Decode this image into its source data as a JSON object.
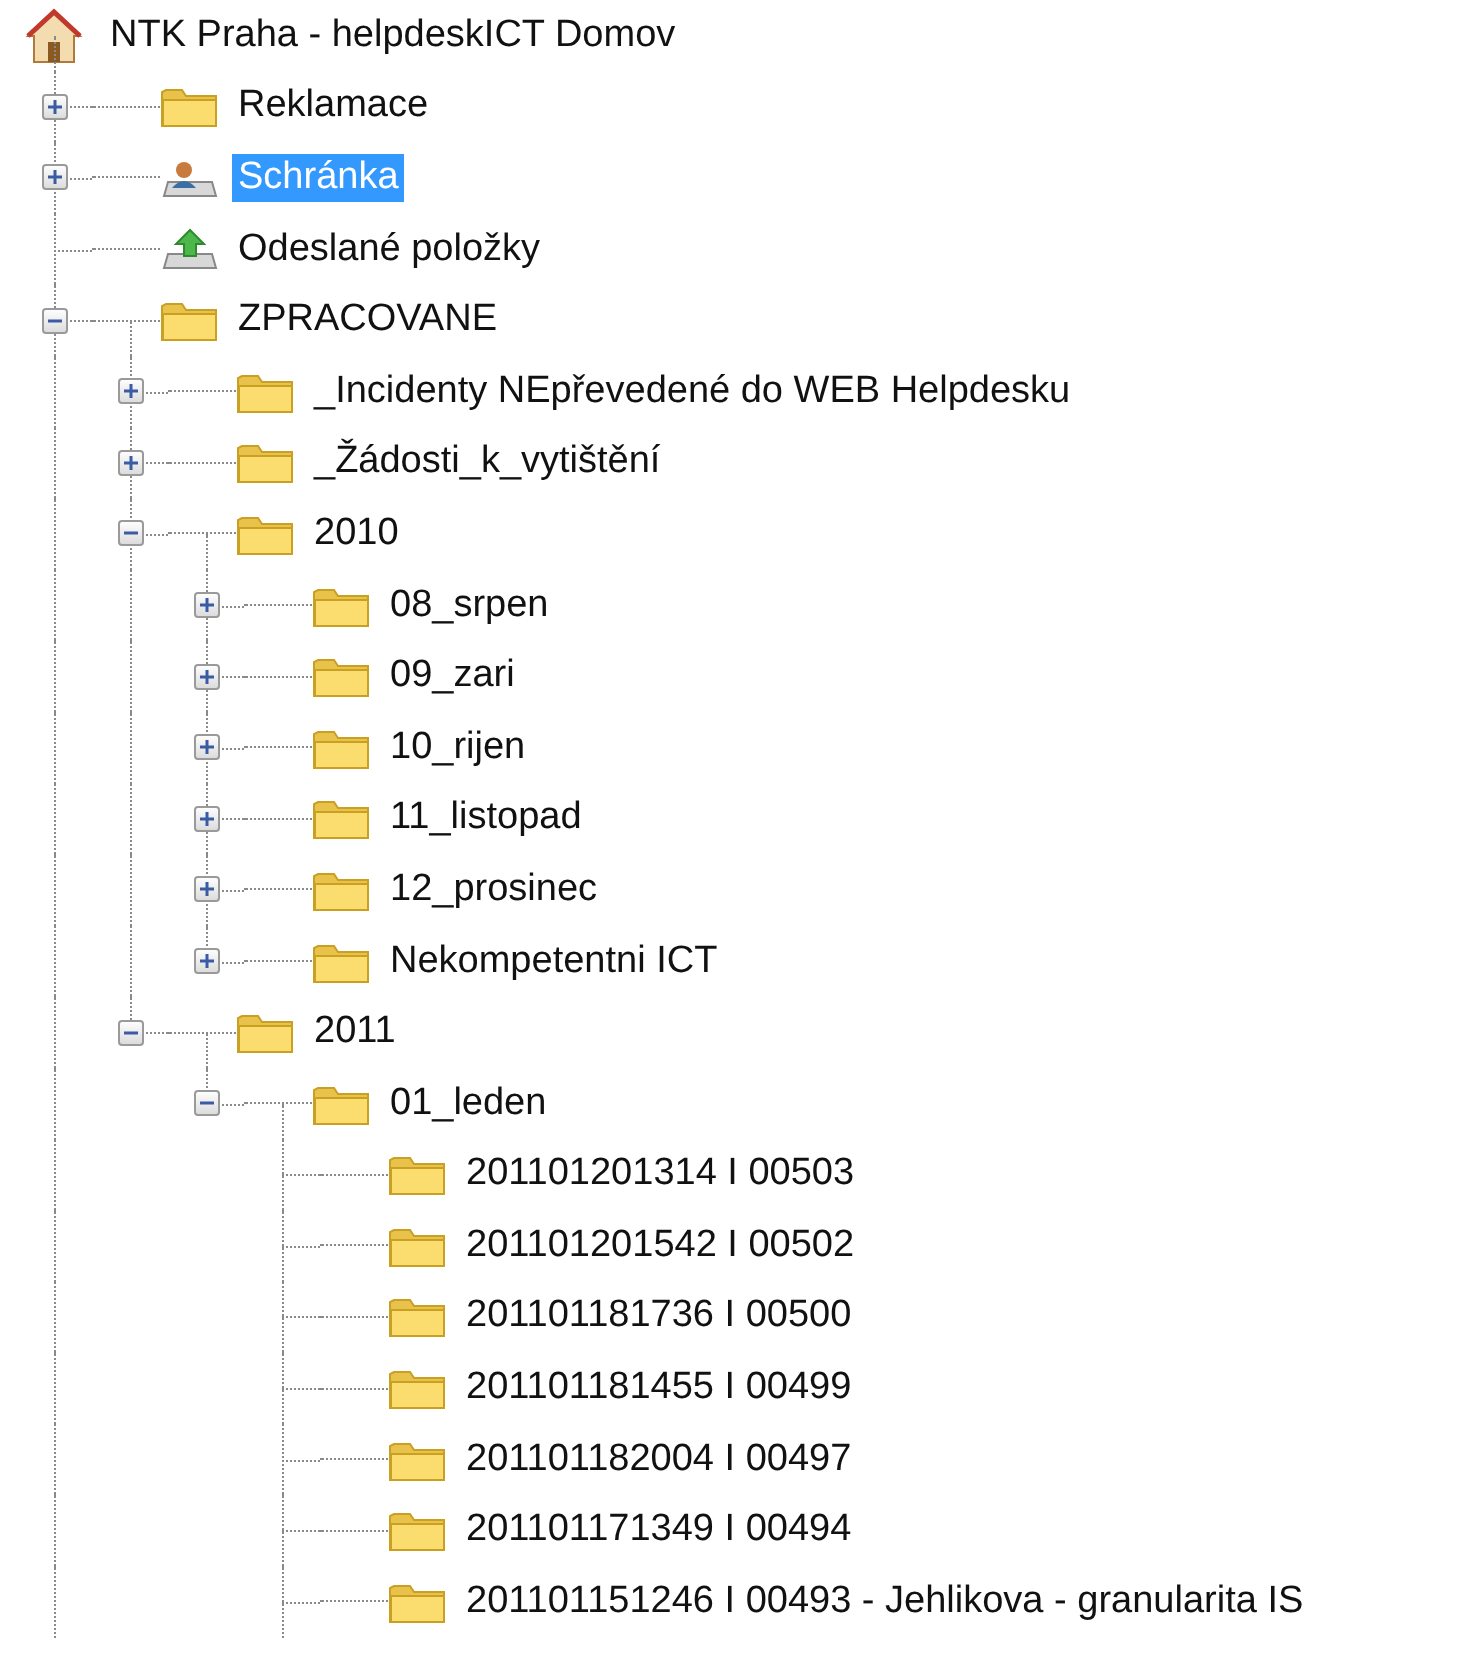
{
  "tree": {
    "label": "NTK Praha - helpdeskICT Domov",
    "kind": "home",
    "selected": false,
    "children": [
      {
        "label": "Reklamace",
        "kind": "folder",
        "selected": false,
        "expanded": false
      },
      {
        "label": "Schránka",
        "kind": "inbox",
        "selected": true,
        "expanded": false
      },
      {
        "label": "Odeslané položky",
        "kind": "outbox",
        "selected": false
      },
      {
        "label": "ZPRACOVANE",
        "kind": "folder",
        "selected": false,
        "expanded": true,
        "more_below": true,
        "children": [
          {
            "label": "_Incidenty NEpřevedené do WEB Helpdesku",
            "kind": "folder",
            "selected": false,
            "expanded": false
          },
          {
            "label": "_Žádosti_k_vytištění",
            "kind": "folder",
            "selected": false,
            "expanded": false
          },
          {
            "label": "2010",
            "kind": "folder",
            "selected": false,
            "expanded": true,
            "children": [
              {
                "label": "08_srpen",
                "kind": "folder",
                "selected": false,
                "expanded": false
              },
              {
                "label": "09_zari",
                "kind": "folder",
                "selected": false,
                "expanded": false
              },
              {
                "label": "10_rijen",
                "kind": "folder",
                "selected": false,
                "expanded": false
              },
              {
                "label": "11_listopad",
                "kind": "folder",
                "selected": false,
                "expanded": false
              },
              {
                "label": "12_prosinec",
                "kind": "folder",
                "selected": false,
                "expanded": false
              },
              {
                "label": "Nekompetentni ICT",
                "kind": "folder",
                "selected": false,
                "expanded": false
              }
            ]
          },
          {
            "label": "2011",
            "kind": "folder",
            "selected": false,
            "expanded": true,
            "children": [
              {
                "label": "01_leden",
                "kind": "folder",
                "selected": false,
                "expanded": true,
                "children": [
                  {
                    "label": "201101201314 I 00503",
                    "kind": "folder",
                    "selected": false
                  },
                  {
                    "label": "201101201542 I 00502",
                    "kind": "folder",
                    "selected": false
                  },
                  {
                    "label": "201101181736 I 00500",
                    "kind": "folder",
                    "selected": false
                  },
                  {
                    "label": "201101181455 I 00499",
                    "kind": "folder",
                    "selected": false
                  },
                  {
                    "label": "201101182004 I 00497",
                    "kind": "folder",
                    "selected": false
                  },
                  {
                    "label": "201101171349 I 00494",
                    "kind": "folder",
                    "selected": false
                  },
                  {
                    "label": "201101151246 I 00493 - Jehlikova - granularita IS",
                    "kind": "folder",
                    "selected": false,
                    "more_below": true
                  }
                ]
              }
            ]
          }
        ]
      }
    ]
  }
}
